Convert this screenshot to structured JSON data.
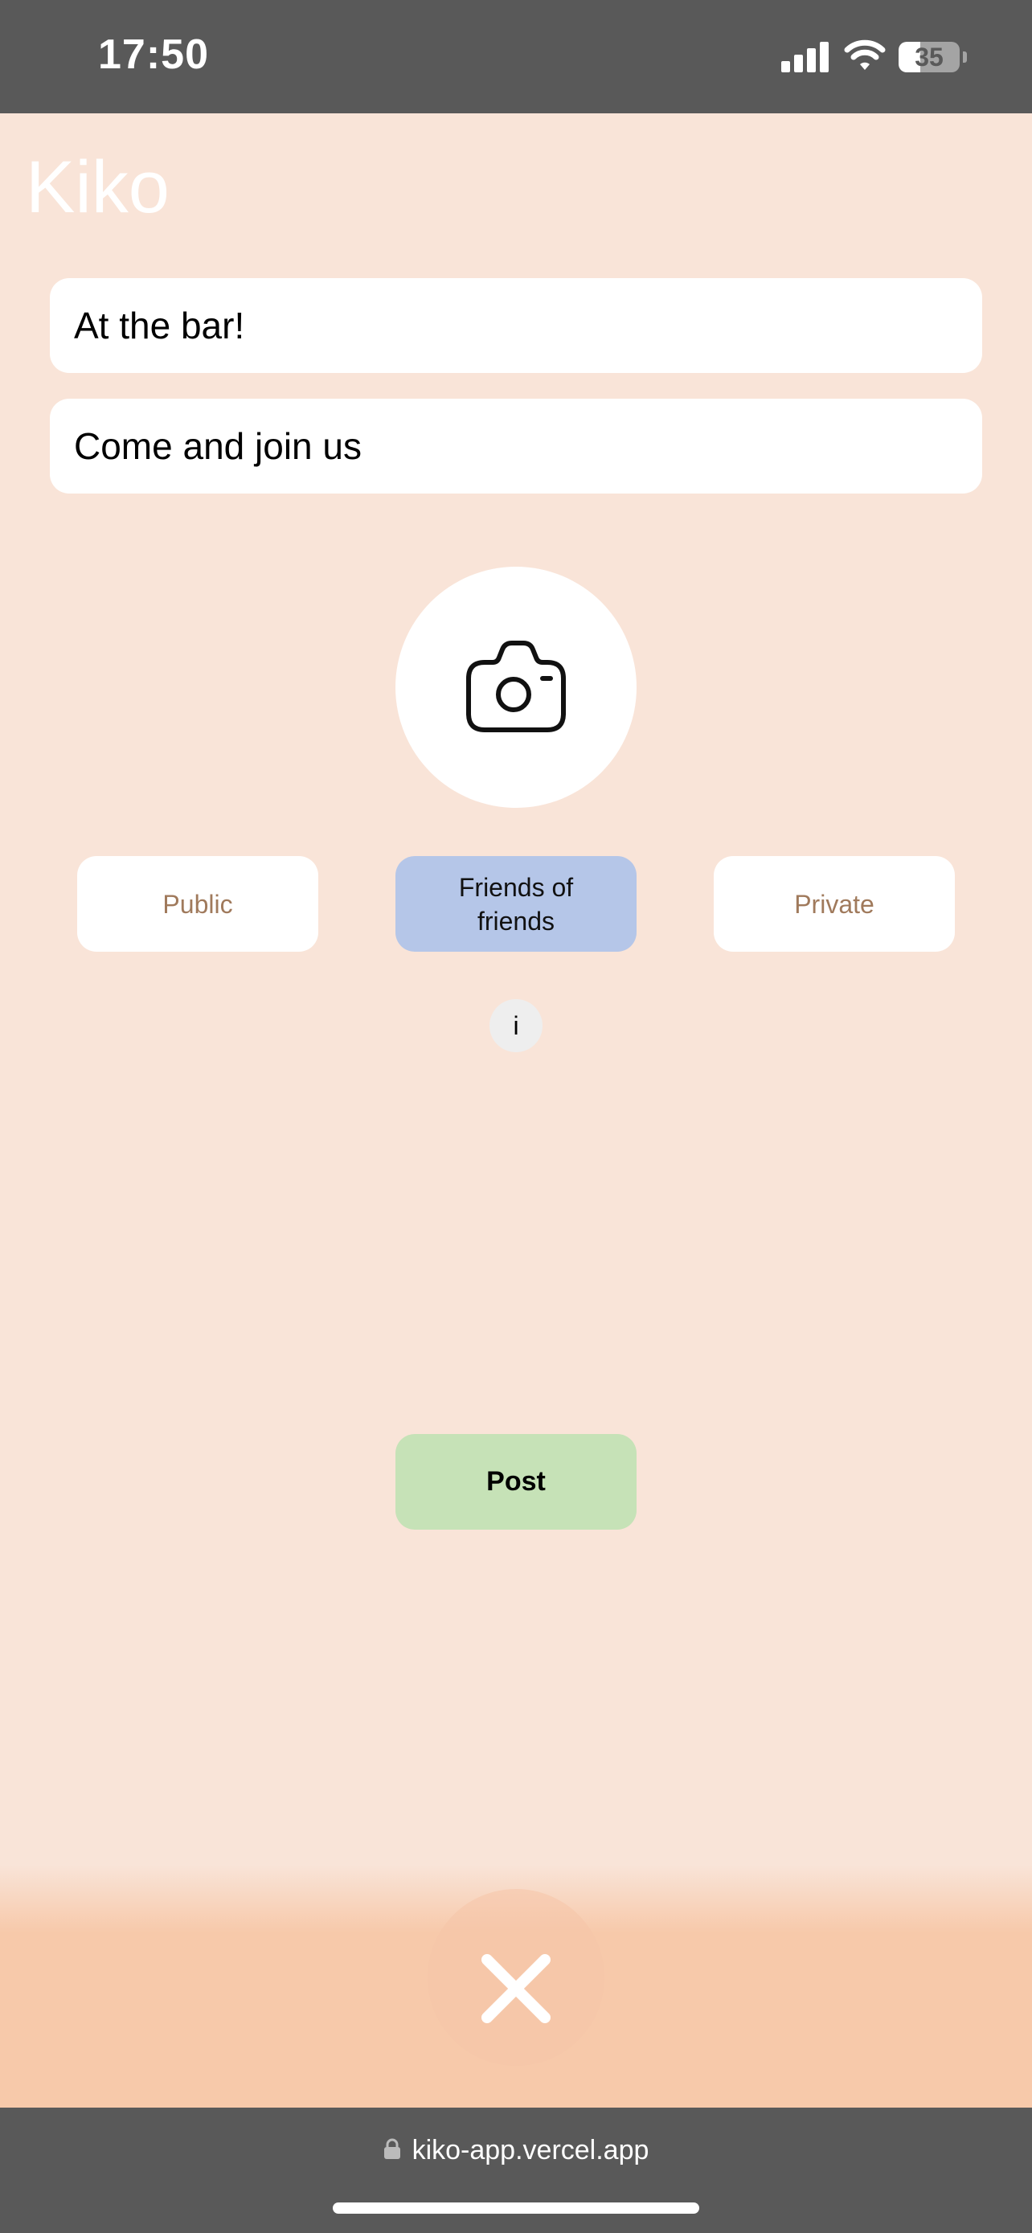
{
  "status_bar": {
    "time": "17:50",
    "battery_level": "35",
    "battery_fraction": 0.35,
    "icons": [
      "signal-icon",
      "wifi-icon",
      "battery-icon"
    ]
  },
  "header": {
    "title": "Kiko"
  },
  "form": {
    "title_value": "At the bar!",
    "description_value": "Come and join us",
    "camera_icon": "camera-icon"
  },
  "visibility": {
    "options": [
      {
        "label": "Public",
        "selected": false
      },
      {
        "label": "Friends of friends",
        "selected": true
      },
      {
        "label": "Private",
        "selected": false
      }
    ],
    "info_label": "i"
  },
  "actions": {
    "post_label": "Post"
  },
  "bottom_nav": {
    "close_icon": "close-icon"
  },
  "browser": {
    "url": "kiko-app.vercel.app"
  },
  "colors": {
    "background": "#f9e4d8",
    "selected_option": "#b5c6e8",
    "post_button": "#c6e2b7",
    "unselected_text": "#a07a5c",
    "system_bar": "#595959"
  }
}
